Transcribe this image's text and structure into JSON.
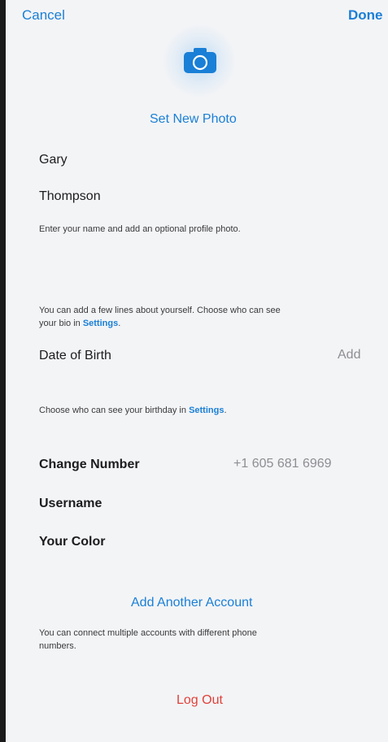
{
  "nav": {
    "cancel": "Cancel",
    "done": "Done"
  },
  "photo": {
    "icon": "camera-icon",
    "set_new_label": "Set New Photo"
  },
  "name": {
    "first": "Gary",
    "last": "Thompson",
    "hint": "Enter your name and add an optional profile photo."
  },
  "bio": {
    "hint_line1": "You can add a few lines about yourself. Choose who can see",
    "hint_line2_prefix": "your bio in ",
    "hint_link": "Settings",
    "hint_suffix": "."
  },
  "birth": {
    "label": "Date of Birth",
    "value": "Add",
    "hint_prefix": "Choose who can see your birthday in ",
    "hint_link": "Settings",
    "hint_suffix": "."
  },
  "account": {
    "change_number_label": "Change Number",
    "phone": "+1 605 681 6969",
    "username_label": "Username",
    "color_label": "Your Color"
  },
  "add_account": {
    "label": "Add Another Account",
    "hint_line1": "You can connect multiple accounts with different phone",
    "hint_line2": "numbers."
  },
  "logout_label": "Log Out",
  "colors": {
    "accent": "#1a7fd6",
    "destructive": "#e0413a",
    "background": "#f3f4f6"
  }
}
